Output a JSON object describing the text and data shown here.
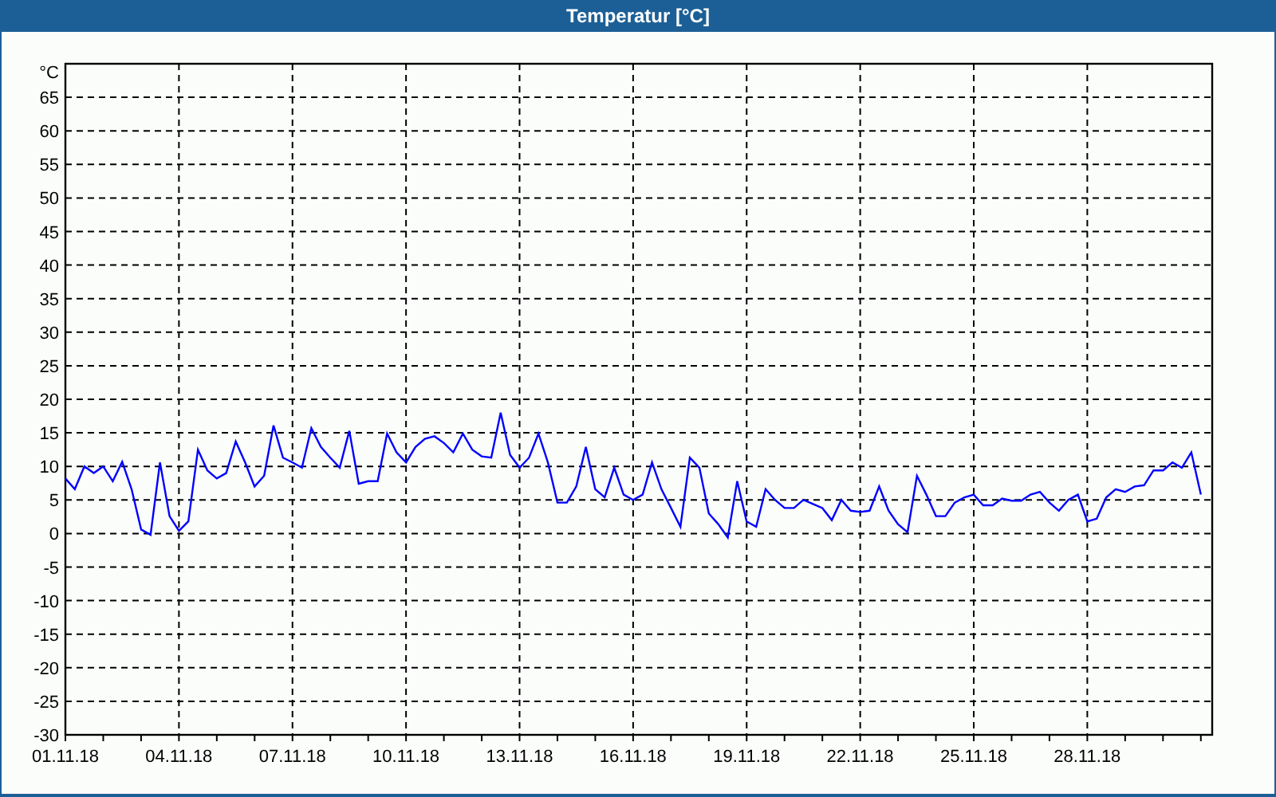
{
  "window": {
    "title": "Temperatur [°C]"
  },
  "chart": {
    "chart_data": {
      "type": "line",
      "ylabel": "°C",
      "grid": true,
      "ylim": [
        -30,
        70
      ],
      "yticks": [
        -30,
        -25,
        -20,
        -15,
        -10,
        -5,
        0,
        5,
        10,
        15,
        20,
        25,
        30,
        35,
        40,
        45,
        50,
        55,
        60,
        65
      ],
      "categories": [
        "01.11.18",
        null,
        null,
        null,
        null,
        null,
        null,
        null,
        null,
        null,
        null,
        null,
        "04.11.18",
        null,
        null,
        null,
        null,
        null,
        null,
        null,
        null,
        null,
        null,
        null,
        "07.11.18",
        null,
        null,
        null,
        null,
        null,
        null,
        null,
        null,
        null,
        null,
        null,
        "10.11.18",
        null,
        null,
        null,
        null,
        null,
        null,
        null,
        null,
        null,
        null,
        null,
        "13.11.18",
        null,
        null,
        null,
        null,
        null,
        null,
        null,
        null,
        null,
        null,
        null,
        "16.11.18",
        null,
        null,
        null,
        null,
        null,
        null,
        null,
        null,
        null,
        null,
        null,
        "19.11.18",
        null,
        null,
        null,
        null,
        null,
        null,
        null,
        null,
        null,
        null,
        null,
        "22.11.18",
        null,
        null,
        null,
        null,
        null,
        null,
        null,
        null,
        null,
        null,
        null,
        "25.11.18",
        null,
        null,
        null,
        null,
        null,
        null,
        null,
        null,
        null,
        null,
        null,
        "28.11.18",
        null,
        null,
        null,
        null,
        null,
        null,
        null,
        null,
        null,
        null,
        null,
        null
      ],
      "series": [
        {
          "color": "#0000ff",
          "values": [
            8.2,
            6.6,
            10,
            9,
            10,
            7.8,
            10.7,
            6.6,
            0.6,
            -0.2,
            10.6,
            2.6,
            0.4,
            1.8,
            12.5,
            9.4,
            8.2,
            9,
            13.7,
            10.6,
            7,
            8.6,
            16.1,
            11.3,
            10.6,
            9.8,
            15.7,
            12.9,
            11.3,
            9.8,
            15.3,
            7.4,
            7.8,
            7.8,
            14.9,
            12.1,
            10.6,
            12.9,
            14.1,
            14.5,
            13.5,
            12.1,
            14.9,
            12.5,
            11.5,
            11.3,
            18,
            11.7,
            9.8,
            11.3,
            14.9,
            10.6,
            4.6,
            4.6,
            7,
            12.9,
            6.6,
            5.4,
            9.8,
            5.8,
            5,
            5.8,
            10.6,
            6.6,
            3.8,
            1,
            11.3,
            9.8,
            3,
            1.4,
            -0.6,
            7.8,
            1.8,
            1,
            6.6,
            5,
            3.8,
            3.8,
            5,
            4.4,
            3.8,
            2,
            5,
            3.4,
            3.2,
            3.4,
            7,
            3.4,
            1.4,
            0.2,
            8.6,
            5.8,
            2.6,
            2.6,
            4.6,
            5.4,
            5.8,
            4.2,
            4.2,
            5.2,
            4.9,
            4.9,
            5.8,
            6.2,
            4.6,
            3.4,
            5,
            5.8,
            1.8,
            2.2,
            5.4,
            6.6,
            6.2,
            7,
            7.2,
            9.4,
            9.4,
            10.6,
            9.8,
            12.1,
            5.8
          ]
        }
      ]
    }
  }
}
